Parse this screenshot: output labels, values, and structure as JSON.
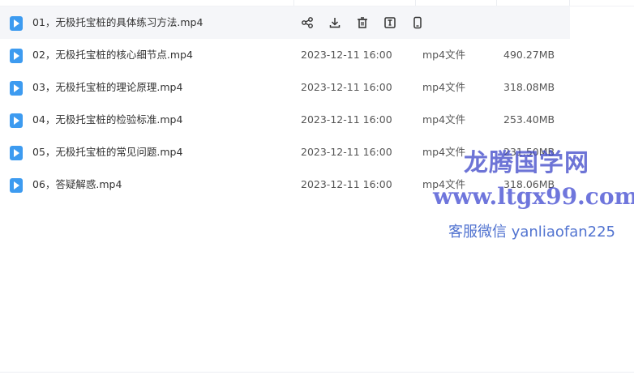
{
  "files": [
    {
      "name": "01，无极托宝桩的具体练习方法.mp4",
      "date": "",
      "type": "",
      "size": "",
      "hovered": true
    },
    {
      "name": "02，无极托宝桩的核心细节点.mp4",
      "date": "2023-12-11 16:00",
      "type": "mp4文件",
      "size": "490.27MB"
    },
    {
      "name": "03，无极托宝桩的理论原理.mp4",
      "date": "2023-12-11 16:00",
      "type": "mp4文件",
      "size": "318.08MB"
    },
    {
      "name": "04，无极托宝桩的检验标准.mp4",
      "date": "2023-12-11 16:00",
      "type": "mp4文件",
      "size": "253.40MB"
    },
    {
      "name": "05，无极托宝桩的常见问题.mp4",
      "date": "2023-12-11 16:00",
      "type": "mp4文件",
      "size": "231.50MB"
    },
    {
      "name": "06，答疑解惑.mp4",
      "date": "2023-12-11 16:00",
      "type": "mp4文件",
      "size": "318.06MB"
    }
  ],
  "row_actions": [
    {
      "id": "share",
      "icon": "share-icon"
    },
    {
      "id": "download",
      "icon": "download-icon"
    },
    {
      "id": "delete",
      "icon": "trash-icon"
    },
    {
      "id": "rename",
      "icon": "rename-icon"
    },
    {
      "id": "phone",
      "icon": "phone-icon"
    }
  ],
  "watermark": {
    "line1": "龙腾国学网",
    "line2": "www.ltgx99.com",
    "line3": "客服微信 yanliaofan225"
  },
  "colors": {
    "file_icon": "#3d9bf0",
    "hover_row": "#f5f6f9"
  }
}
